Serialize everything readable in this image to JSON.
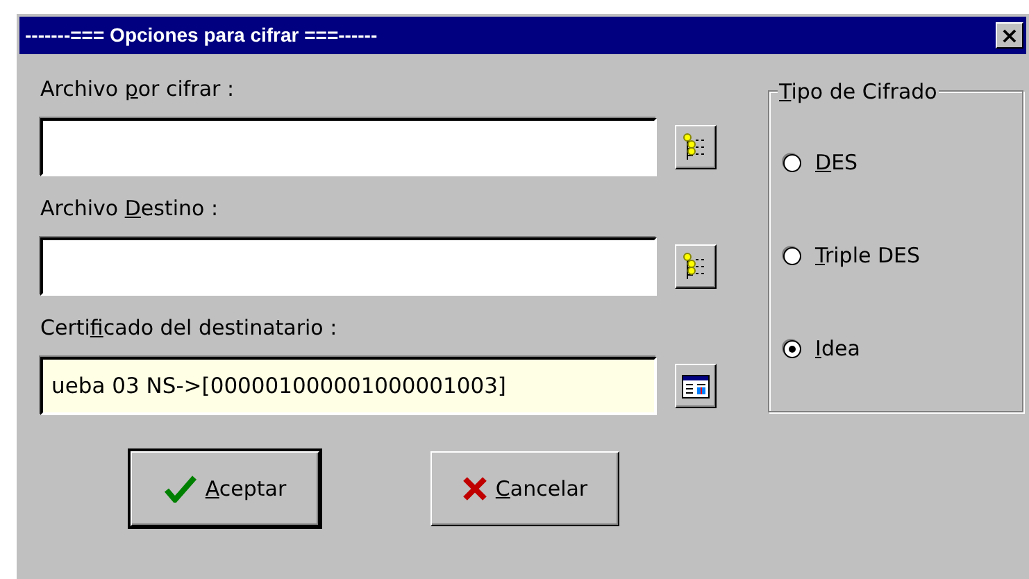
{
  "window": {
    "title": "-------=== Opciones para cifrar ===------",
    "close": "×"
  },
  "fields": [
    {
      "label": {
        "before": "Archivo ",
        "key": "p",
        "after": "or cifrar :"
      },
      "highlighted": false,
      "kind": "tree"
    },
    {
      "label": {
        "before": "Archivo ",
        "key": "D",
        "after": "estino :"
      },
      "highlighted": false,
      "kind": "tree"
    },
    {
      "label": {
        "before": "Certi",
        "key": "f",
        "after": "icado del destinatario :"
      },
      "value": "ueba 03 NS->[000001000001000001003]",
      "highlighted": true,
      "kind": "window"
    }
  ],
  "cipher_group": {
    "title": {
      "key": "T",
      "after": "ipo de Cifrado"
    },
    "options": [
      {
        "label": {
          "key": "D",
          "after": "ES"
        },
        "selected": false
      },
      {
        "label": {
          "key": "T",
          "after": "riple DES"
        },
        "selected": false
      },
      {
        "label": {
          "key": "I",
          "after": "dea"
        },
        "selected": true
      }
    ]
  },
  "buttons": [
    {
      "kind": "ok",
      "label": {
        "key": "A",
        "after": "ceptar"
      },
      "default": true
    },
    {
      "kind": "cancel",
      "label": {
        "key": "C",
        "after": "ancelar"
      },
      "default": false
    }
  ]
}
